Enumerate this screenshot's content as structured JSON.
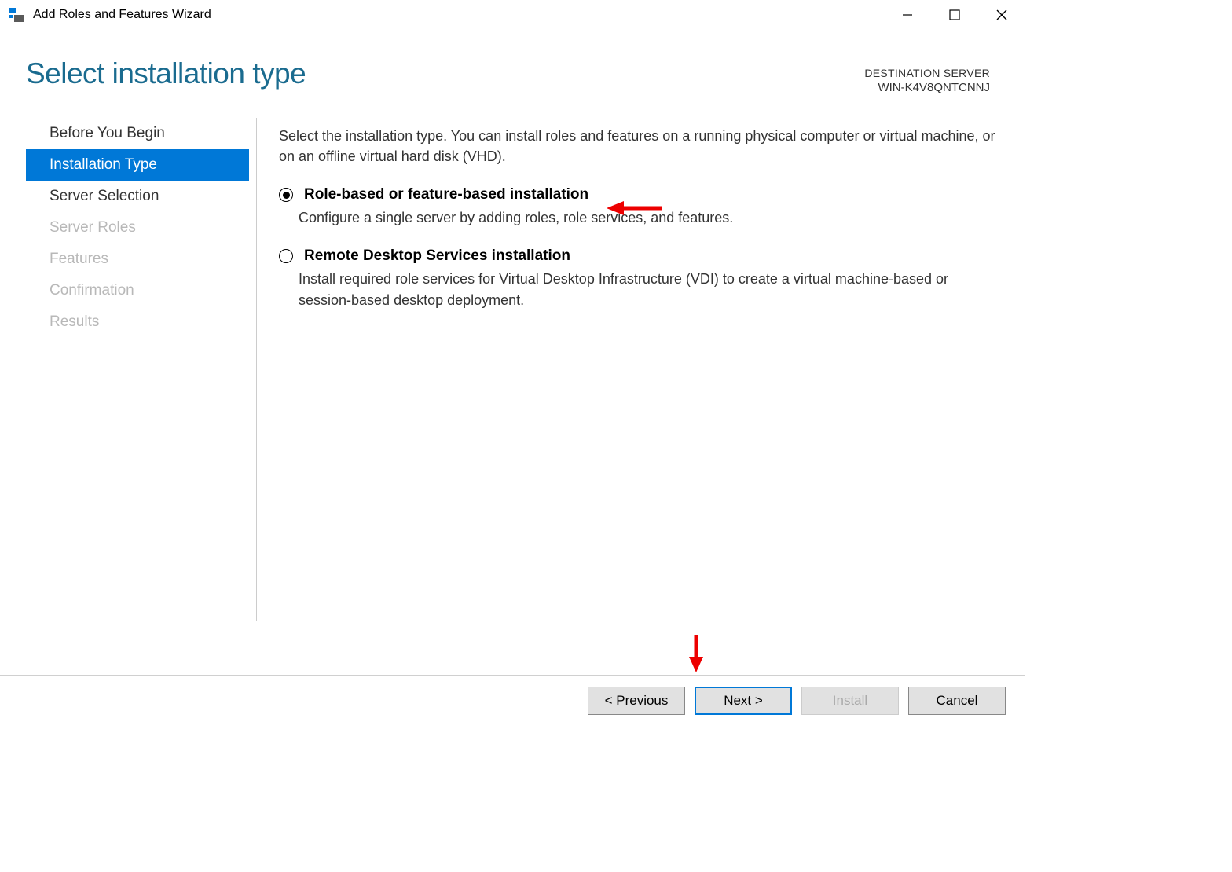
{
  "window": {
    "title": "Add Roles and Features Wizard"
  },
  "header": {
    "page_title": "Select installation type",
    "destination_label": "DESTINATION SERVER",
    "destination_server": "WIN-K4V8QNTCNNJ"
  },
  "sidebar": {
    "items": [
      {
        "label": "Before You Begin",
        "state": "enabled"
      },
      {
        "label": "Installation Type",
        "state": "active"
      },
      {
        "label": "Server Selection",
        "state": "enabled"
      },
      {
        "label": "Server Roles",
        "state": "disabled"
      },
      {
        "label": "Features",
        "state": "disabled"
      },
      {
        "label": "Confirmation",
        "state": "disabled"
      },
      {
        "label": "Results",
        "state": "disabled"
      }
    ]
  },
  "main": {
    "description": "Select the installation type. You can install roles and features on a running physical computer or virtual machine, or on an offline virtual hard disk (VHD).",
    "options": [
      {
        "title": "Role-based or feature-based installation",
        "desc": "Configure a single server by adding roles, role services, and features.",
        "selected": true
      },
      {
        "title": "Remote Desktop Services installation",
        "desc": "Install required role services for Virtual Desktop Infrastructure (VDI) to create a virtual machine-based or session-based desktop deployment.",
        "selected": false
      }
    ]
  },
  "footer": {
    "previous": "< Previous",
    "next": "Next >",
    "install": "Install",
    "cancel": "Cancel"
  }
}
